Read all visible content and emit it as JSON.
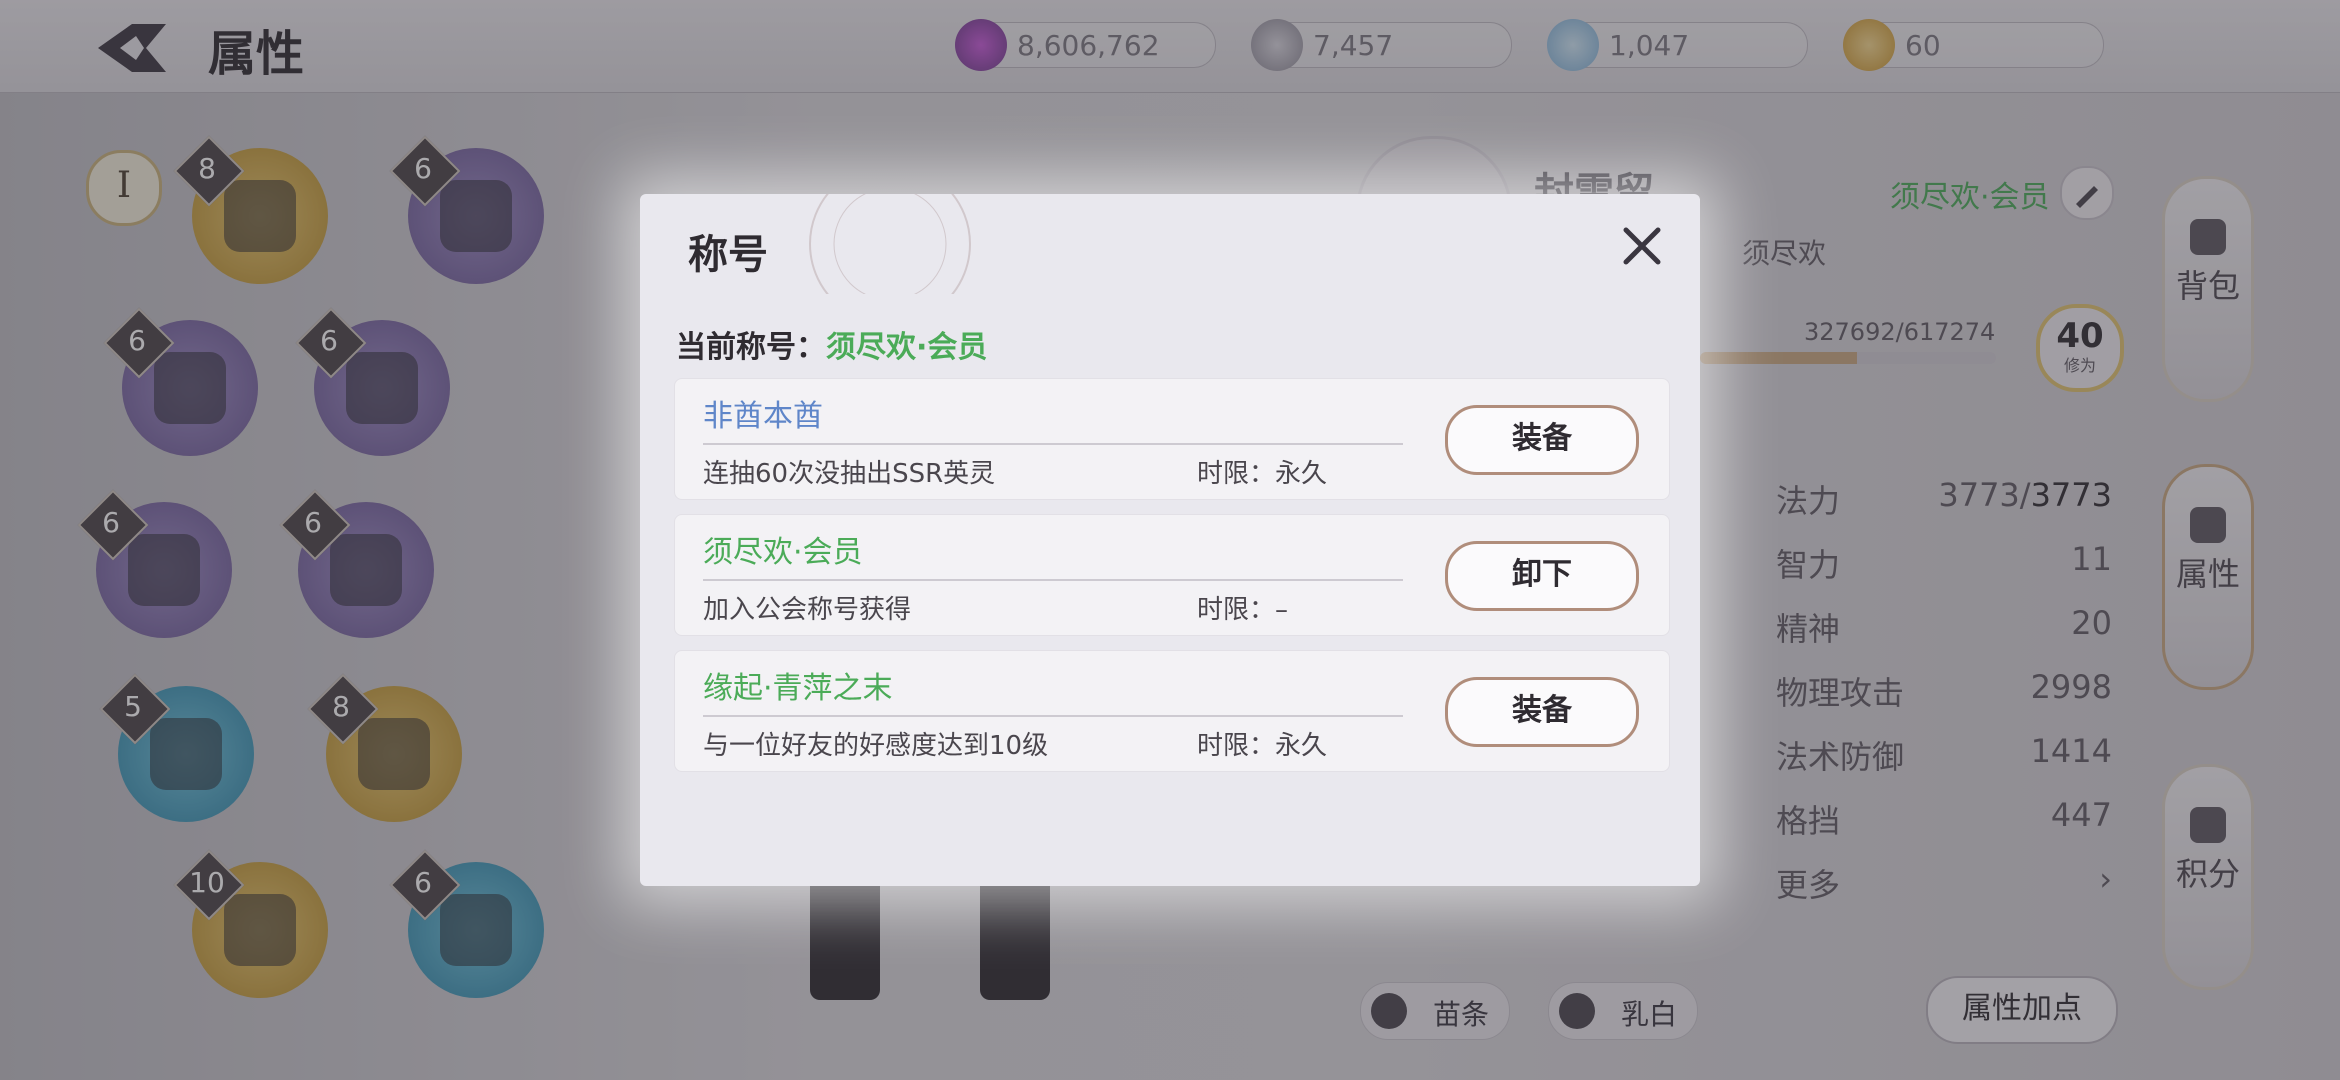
{
  "header": {
    "title": "属性",
    "currencies": [
      {
        "icon": "crystal-icon",
        "value": "8,606,762"
      },
      {
        "icon": "silver-coin-icon",
        "value": "7,457"
      },
      {
        "icon": "gem-icon",
        "value": "1,047"
      },
      {
        "icon": "gold-coin-icon",
        "value": "60"
      }
    ]
  },
  "equipment": {
    "tier": "I",
    "slots": [
      {
        "level": "8"
      },
      {
        "level": "6"
      },
      {
        "level": "6"
      },
      {
        "level": "6"
      },
      {
        "level": "6"
      },
      {
        "level": "6"
      },
      {
        "level": "5"
      },
      {
        "level": "8"
      },
      {
        "level": "10"
      },
      {
        "level": "6"
      }
    ]
  },
  "character": {
    "name": "封雲留",
    "title_badge": "须尽欢·会员",
    "guild": "须尽欢",
    "exp": "327692/617274",
    "exp_fraction": 0.531,
    "level": "40",
    "level_label": "修为"
  },
  "stats": [
    {
      "label": "法力",
      "value_a": "3773/",
      "value_b": "3773"
    },
    {
      "label": "智力",
      "value": "11"
    },
    {
      "label": "精神",
      "value": "20"
    },
    {
      "label": "物理攻击",
      "value": "2998"
    },
    {
      "label": "法术防御",
      "value": "1414"
    },
    {
      "label": "格挡",
      "value": "447"
    }
  ],
  "more_label": "更多",
  "bottom": {
    "tag1": "苗条",
    "tag2": "乳白",
    "attr_points_button": "属性加点"
  },
  "side_nav": [
    {
      "label": "背包",
      "icon": "backpack-icon"
    },
    {
      "label": "属性",
      "icon": "attribute-icon",
      "active": true
    },
    {
      "label": "积分",
      "icon": "points-icon"
    }
  ],
  "modal": {
    "title": "称号",
    "current_label": "当前称号：",
    "current_value": "须尽欢·会员",
    "titles": [
      {
        "name": "非酋本酋",
        "color": "#5f86c9",
        "desc": "连抽60次没抽出SSR英灵",
        "limit": "时限：永久",
        "button": "装备"
      },
      {
        "name": "须尽欢·会员",
        "color": "#4bab58",
        "desc": "加入公会称号获得",
        "limit": "时限：–",
        "button": "卸下"
      },
      {
        "name": "缘起·青萍之末",
        "color": "#4bab58",
        "desc": "与一位好友的好感度达到10级",
        "limit": "时限：永久",
        "button": "装备"
      }
    ]
  },
  "colors": {
    "accent_green": "#4bab58",
    "accent_blue": "#5f86c9",
    "button_border": "#b08d7b"
  }
}
